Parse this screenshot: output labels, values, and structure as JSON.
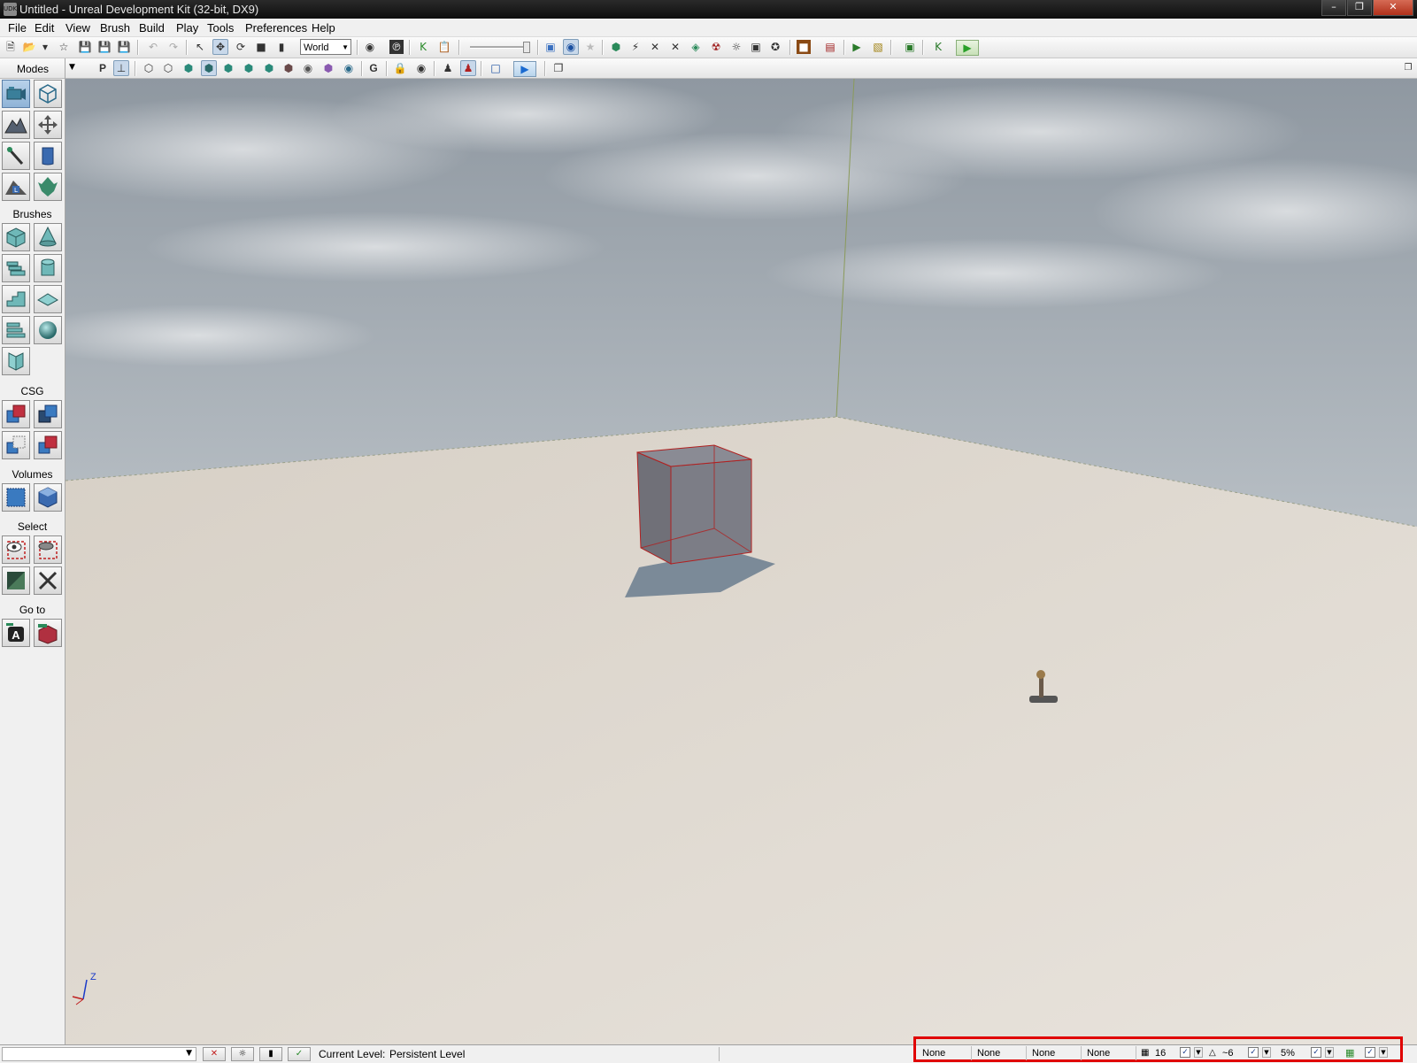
{
  "window": {
    "title": "Untitled - Unreal Development Kit (32-bit, DX9)",
    "icon_text": "UDK",
    "minimize_icon": "minimize-icon",
    "maximize_icon": "restore-icon",
    "close_icon": "close-icon"
  },
  "menu": [
    "File",
    "Edit",
    "View",
    "Brush",
    "Build",
    "Play",
    "Tools",
    "Preferences",
    "Help"
  ],
  "toolbar": {
    "coordinate_system": "World"
  },
  "toolbar2": {
    "perspective_label": "P",
    "grid_label": "G"
  },
  "modes_panel": {
    "title": "Modes",
    "sections": {
      "brushes": "Brushes",
      "csg": "CSG",
      "volumes": "Volumes",
      "select": "Select",
      "goto": "Go to"
    },
    "goto_actor_label": "A"
  },
  "viewport": {
    "axis_z": "Z",
    "colors": {
      "sky_top": "#8f98a1",
      "sky_bottom": "#c9ced2",
      "floor": "#e2dcd3",
      "brush_wire": "#b02020"
    }
  },
  "statusbar": {
    "current_level_label": "Current Level:",
    "current_level_value": "Persistent Level",
    "fields": [
      "None",
      "None",
      "None",
      "None"
    ],
    "grid_snap": "16",
    "rotation_snap": "~6",
    "scale_snap": "5%"
  }
}
